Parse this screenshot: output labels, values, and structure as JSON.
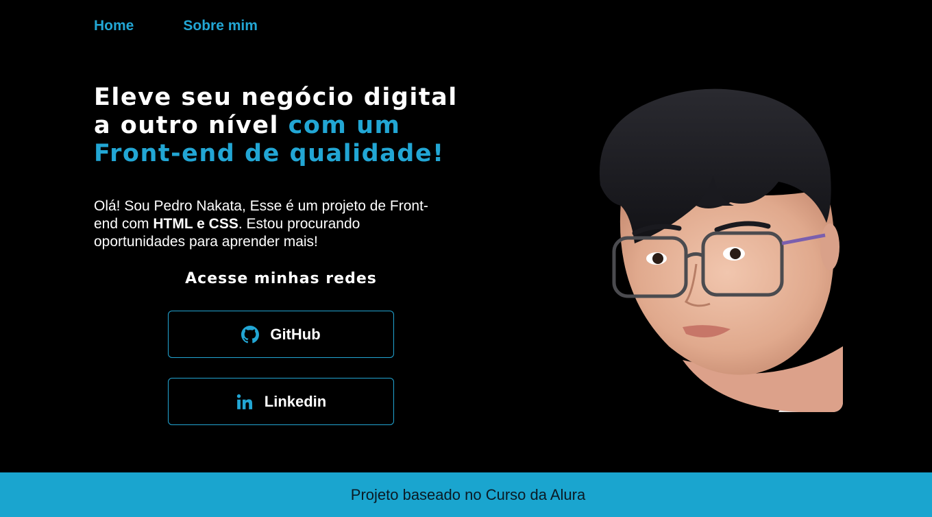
{
  "nav": {
    "home_label": "Home",
    "about_label": "Sobre mim"
  },
  "hero": {
    "headline_part1": "Eleve seu negócio digital a outro nível ",
    "headline_part2": "com um Front-end de qualidade!",
    "intro_part1": "Olá! Sou Pedro Nakata, Esse é um projeto de Front-end com ",
    "intro_bold": "HTML e CSS",
    "intro_part2": ". Estou procurando oportunidades para aprender mais!"
  },
  "social": {
    "title": "Acesse minhas redes",
    "github_label": "GitHub",
    "github_icon": "github-icon",
    "linkedin_label": "Linkedin",
    "linkedin_icon": "linkedin-icon"
  },
  "footer": {
    "text": "Projeto baseado no Curso da Alura"
  },
  "colors": {
    "accent": "#22a6d4",
    "footer_bg": "#1aa5cf",
    "background": "#000000"
  }
}
